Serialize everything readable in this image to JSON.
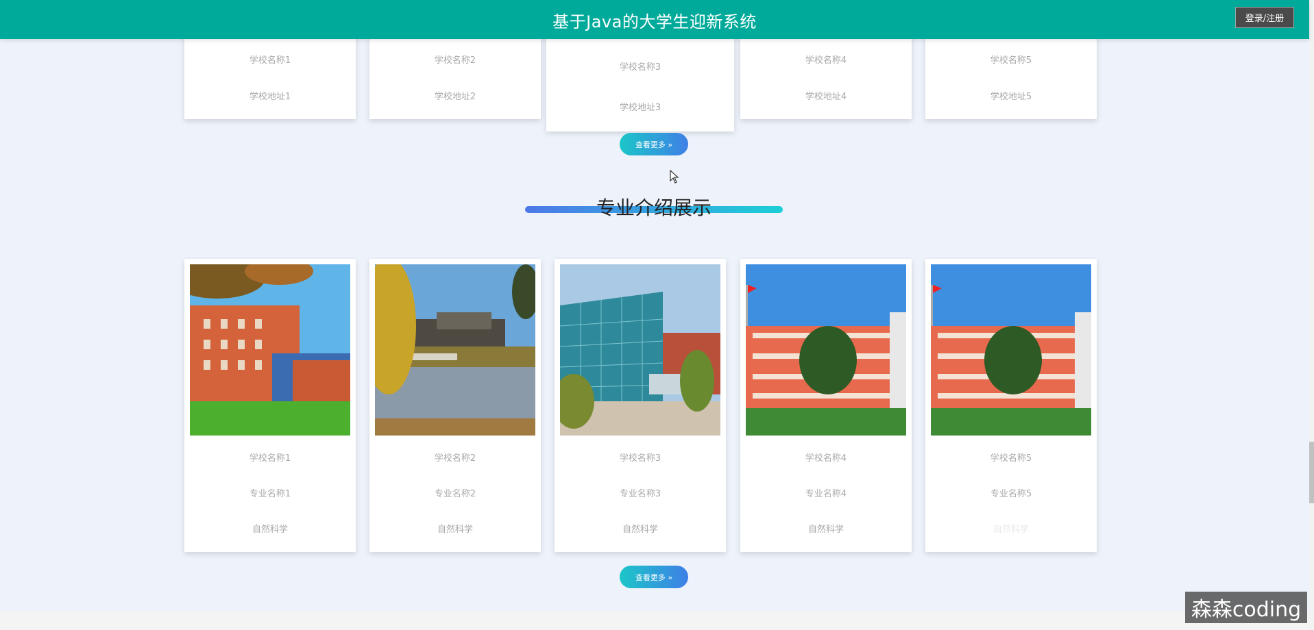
{
  "header": {
    "title": "基于Java的大学生迎新系统",
    "login_label": "登录/注册"
  },
  "schools": [
    {
      "name": "学校名称1",
      "address": "学校地址1"
    },
    {
      "name": "学校名称2",
      "address": "学校地址2"
    },
    {
      "name": "学校名称3",
      "address": "学校地址3"
    },
    {
      "name": "学校名称4",
      "address": "学校地址4"
    },
    {
      "name": "学校名称5",
      "address": "学校地址5"
    }
  ],
  "schools_more_label": "查看更多 »",
  "majors_section": {
    "title": "专业介绍展示"
  },
  "majors": [
    {
      "school": "学校名称1",
      "major": "专业名称1",
      "category": "自然科学"
    },
    {
      "school": "学校名称2",
      "major": "专业名称2",
      "category": "自然科学"
    },
    {
      "school": "学校名称3",
      "major": "专业名称3",
      "category": "自然科学"
    },
    {
      "school": "学校名称4",
      "major": "专业名称4",
      "category": "自然科学"
    },
    {
      "school": "学校名称5",
      "major": "专业名称5",
      "category": "自然科学"
    }
  ],
  "majors_more_label": "查看更多 »",
  "watermark": "森森coding",
  "colors": {
    "header": "#00aa9a",
    "page_bg": "#eef3fb",
    "button_gradient_start": "#1bc6c8",
    "button_gradient_end": "#3f7fe6"
  },
  "icons": {
    "cursor": "mouse-pointer-icon"
  }
}
